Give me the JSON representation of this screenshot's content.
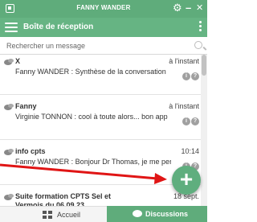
{
  "window": {
    "title": "FANNY WANDER",
    "controls": {
      "settings": "⚙",
      "minimize": "–",
      "close": "✕"
    }
  },
  "header": {
    "heading": "Boîte de réception"
  },
  "search": {
    "placeholder": "Rechercher un message"
  },
  "conversations": [
    {
      "name": "X",
      "time": "à l'instant",
      "preview": "Fanny WANDER : Synthèse de la conversation",
      "badges": [
        "i",
        "?"
      ]
    },
    {
      "name": "Fanny",
      "time": "à l'instant",
      "preview": "Virginie TONNON : cool à toute alors... bon app",
      "badges": [
        "i",
        "?"
      ]
    },
    {
      "name": "info cpts",
      "time": "10:14",
      "preview": "Fanny WANDER : Bonjour Dr Thomas, je me permets",
      "badges": [
        "i",
        "?"
      ]
    },
    {
      "name": "Suite formation CPTS Sel et Vermois du 06.09.23",
      "time": "18 sept.",
      "preview": "",
      "badges": []
    }
  ],
  "fab": {
    "symbol": "+"
  },
  "bottom_nav": {
    "home_label": "Accueil",
    "discussions_label": "Discussions"
  },
  "colors": {
    "brand_green": "#5fac7b",
    "header_green": "#66b483",
    "annotation_arrow": "#e01515"
  }
}
